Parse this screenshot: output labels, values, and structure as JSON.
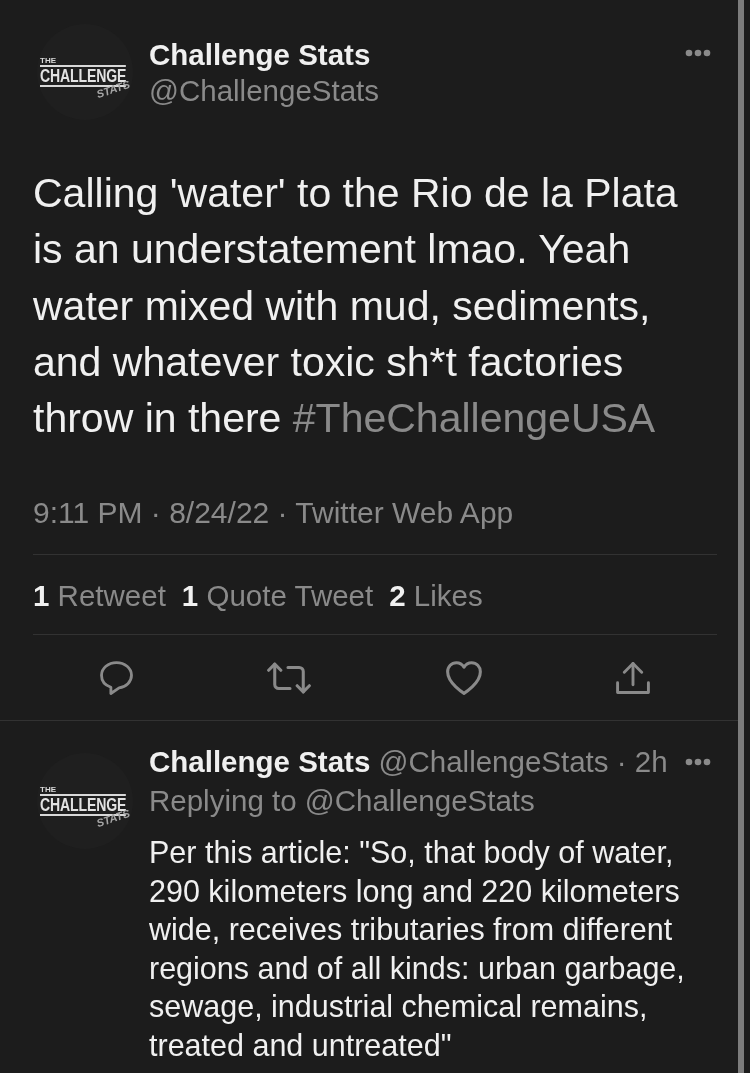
{
  "tweet": {
    "author": {
      "name": "Challenge Stats",
      "handle": "@ChallengeStats",
      "avatar": {
        "small_text": "THE",
        "title": "CHALLENGE",
        "script_text": "STATS"
      }
    },
    "text": [
      {
        "kind": "plain",
        "text": "Calling 'water' to the Rio de la Plata is an understatement lmao. Yeah water mixed with mud, sediments, and whatever toxic sh*t factories throw in there"
      },
      {
        "kind": "hashtag",
        "text": "#TheChallengeUSA"
      }
    ],
    "meta": "9:11 PM · 8/24/22 · Twitter Web App",
    "stats": [
      {
        "count": "1",
        "label": "Retweet"
      },
      {
        "count": "1",
        "label": "Quote Tweet"
      },
      {
        "count": "2",
        "label": "Likes"
      }
    ],
    "actions": [
      {
        "kind": "reply"
      },
      {
        "kind": "retweet"
      },
      {
        "kind": "like"
      },
      {
        "kind": "share"
      }
    ]
  },
  "reply": {
    "author": {
      "name": "Challenge Stats",
      "handle_time": "@ChallengeStats · 2h",
      "avatar": {
        "small_text": "THE",
        "title": "CHALLENGE",
        "script_text": "STATS"
      }
    },
    "replying_to": "Replying to @ChallengeStats",
    "text": "Per this article: \"So, that body of water, 290 kilometers long and 220 kilometers wide, receives tributaries from different regions and of all kinds: urban garbage, sewage, industrial chemical remains, treated and untreated\""
  }
}
